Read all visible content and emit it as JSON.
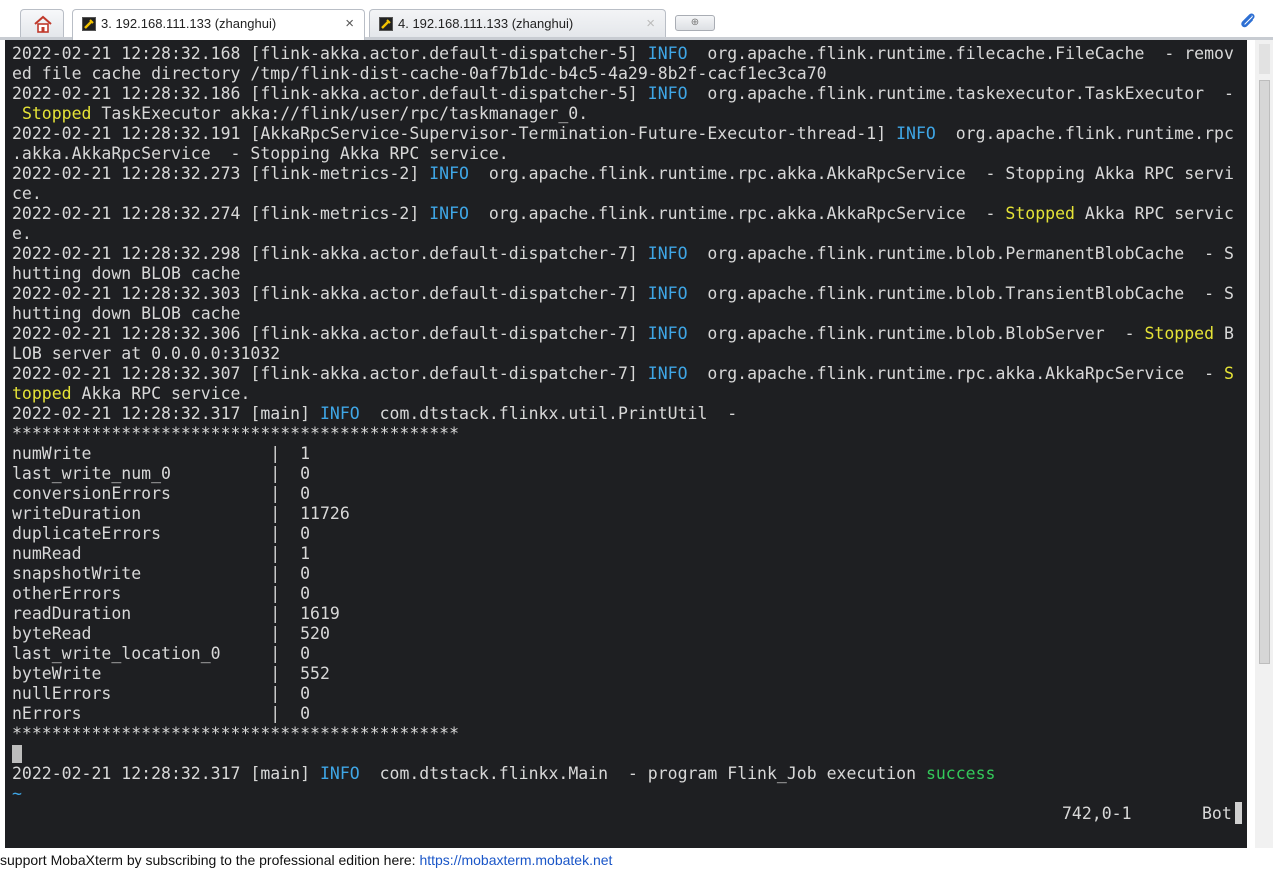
{
  "tabs": {
    "items": [
      {
        "label": "3. 192.168.111.133 (zhanghui)",
        "close": "×"
      },
      {
        "label": "4. 192.168.111.133 (zhanghui)",
        "close": "×"
      }
    ],
    "icons": {
      "home": "home-icon",
      "session": "terminal-session-icon",
      "new_tab": "new-tab-icon",
      "attach": "paperclip-icon"
    },
    "new_tab_glyph": "⊕"
  },
  "terminal": {
    "colors": {
      "background": "#1e1f22",
      "text": "#d8d8d8",
      "info": "#3fa6e6",
      "stopped": "#e5e337",
      "success": "#33c95a"
    },
    "lines": [
      [
        {
          "t": "2022-02-21 12:28:32.168 [flink-akka.actor.default-dispatcher-5] "
        },
        {
          "t": "INFO",
          "c": "info"
        },
        {
          "t": "  org.apache.flink.runtime.filecache.FileCache  - remov"
        }
      ],
      [
        {
          "t": "ed file cache directory /tmp/flink-dist-cache-0af7b1dc-b4c5-4a29-8b2f-cacf1ec3ca70"
        }
      ],
      [
        {
          "t": "2022-02-21 12:28:32.186 [flink-akka.actor.default-dispatcher-5] "
        },
        {
          "t": "INFO",
          "c": "info"
        },
        {
          "t": "  org.apache.flink.runtime.taskexecutor.TaskExecutor  -"
        }
      ],
      [
        {
          "t": " "
        },
        {
          "t": "Stopped",
          "c": "stopped"
        },
        {
          "t": " TaskExecutor akka://flink/user/rpc/taskmanager_0."
        }
      ],
      [
        {
          "t": "2022-02-21 12:28:32.191 [AkkaRpcService-Supervisor-Termination-Future-Executor-thread-1] "
        },
        {
          "t": "INFO",
          "c": "info"
        },
        {
          "t": "  org.apache.flink.runtime.rpc"
        }
      ],
      [
        {
          "t": ".akka.AkkaRpcService  - Stopping Akka RPC service."
        }
      ],
      [
        {
          "t": "2022-02-21 12:28:32.273 [flink-metrics-2] "
        },
        {
          "t": "INFO",
          "c": "info"
        },
        {
          "t": "  org.apache.flink.runtime.rpc.akka.AkkaRpcService  - Stopping Akka RPC servi"
        }
      ],
      [
        {
          "t": "ce."
        }
      ],
      [
        {
          "t": "2022-02-21 12:28:32.274 [flink-metrics-2] "
        },
        {
          "t": "INFO",
          "c": "info"
        },
        {
          "t": "  org.apache.flink.runtime.rpc.akka.AkkaRpcService  - "
        },
        {
          "t": "Stopped",
          "c": "stopped"
        },
        {
          "t": " Akka RPC servic"
        }
      ],
      [
        {
          "t": "e."
        }
      ],
      [
        {
          "t": "2022-02-21 12:28:32.298 [flink-akka.actor.default-dispatcher-7] "
        },
        {
          "t": "INFO",
          "c": "info"
        },
        {
          "t": "  org.apache.flink.runtime.blob.PermanentBlobCache  - S"
        }
      ],
      [
        {
          "t": "hutting down BLOB cache"
        }
      ],
      [
        {
          "t": "2022-02-21 12:28:32.303 [flink-akka.actor.default-dispatcher-7] "
        },
        {
          "t": "INFO",
          "c": "info"
        },
        {
          "t": "  org.apache.flink.runtime.blob.TransientBlobCache  - S"
        }
      ],
      [
        {
          "t": "hutting down BLOB cache"
        }
      ],
      [
        {
          "t": "2022-02-21 12:28:32.306 [flink-akka.actor.default-dispatcher-7] "
        },
        {
          "t": "INFO",
          "c": "info"
        },
        {
          "t": "  org.apache.flink.runtime.blob.BlobServer  - "
        },
        {
          "t": "Stopped",
          "c": "stopped"
        },
        {
          "t": " B"
        }
      ],
      [
        {
          "t": "LOB server at 0.0.0.0:31032"
        }
      ],
      [
        {
          "t": "2022-02-21 12:28:32.307 [flink-akka.actor.default-dispatcher-7] "
        },
        {
          "t": "INFO",
          "c": "info"
        },
        {
          "t": "  org.apache.flink.runtime.rpc.akka.AkkaRpcService  - "
        },
        {
          "t": "S",
          "c": "stopped"
        }
      ],
      [
        {
          "t": "topped",
          "c": "stopped"
        },
        {
          "t": " Akka RPC service."
        }
      ],
      [
        {
          "t": "2022-02-21 12:28:32.317 [main] "
        },
        {
          "t": "INFO",
          "c": "info"
        },
        {
          "t": "  com.dtstack.flinkx.util.PrintUtil  -"
        }
      ],
      [
        {
          "t": "*********************************************"
        }
      ],
      [
        {
          "t": "numWrite                  |  1"
        }
      ],
      [
        {
          "t": "last_write_num_0          |  0"
        }
      ],
      [
        {
          "t": "conversionErrors          |  0"
        }
      ],
      [
        {
          "t": "writeDuration             |  11726"
        }
      ],
      [
        {
          "t": "duplicateErrors           |  0"
        }
      ],
      [
        {
          "t": "numRead                   |  1"
        }
      ],
      [
        {
          "t": "snapshotWrite             |  0"
        }
      ],
      [
        {
          "t": "otherErrors               |  0"
        }
      ],
      [
        {
          "t": "readDuration              |  1619"
        }
      ],
      [
        {
          "t": "byteRead                  |  520"
        }
      ],
      [
        {
          "t": "last_write_location_0     |  0"
        }
      ],
      [
        {
          "t": "byteWrite                 |  552"
        }
      ],
      [
        {
          "t": "nullErrors                |  0"
        }
      ],
      [
        {
          "t": "nErrors                   |  0"
        }
      ],
      [
        {
          "t": "*********************************************"
        }
      ],
      [
        {
          "t": "",
          "c": "cursor"
        }
      ],
      [
        {
          "t": "2022-02-21 12:28:32.317 [main] "
        },
        {
          "t": "INFO",
          "c": "info"
        },
        {
          "t": "  com.dtstack.flinkx.Main  - program Flink_Job execution "
        },
        {
          "t": "success",
          "c": "success"
        }
      ],
      [
        {
          "t": "~",
          "c": "tilde"
        }
      ]
    ],
    "status_position": "742,0-1",
    "status_scroll": "Bot"
  },
  "footer": {
    "text": "support MobaXterm by subscribing to the professional edition here:  ",
    "link": "https://mobaxterm.mobatek.net"
  }
}
